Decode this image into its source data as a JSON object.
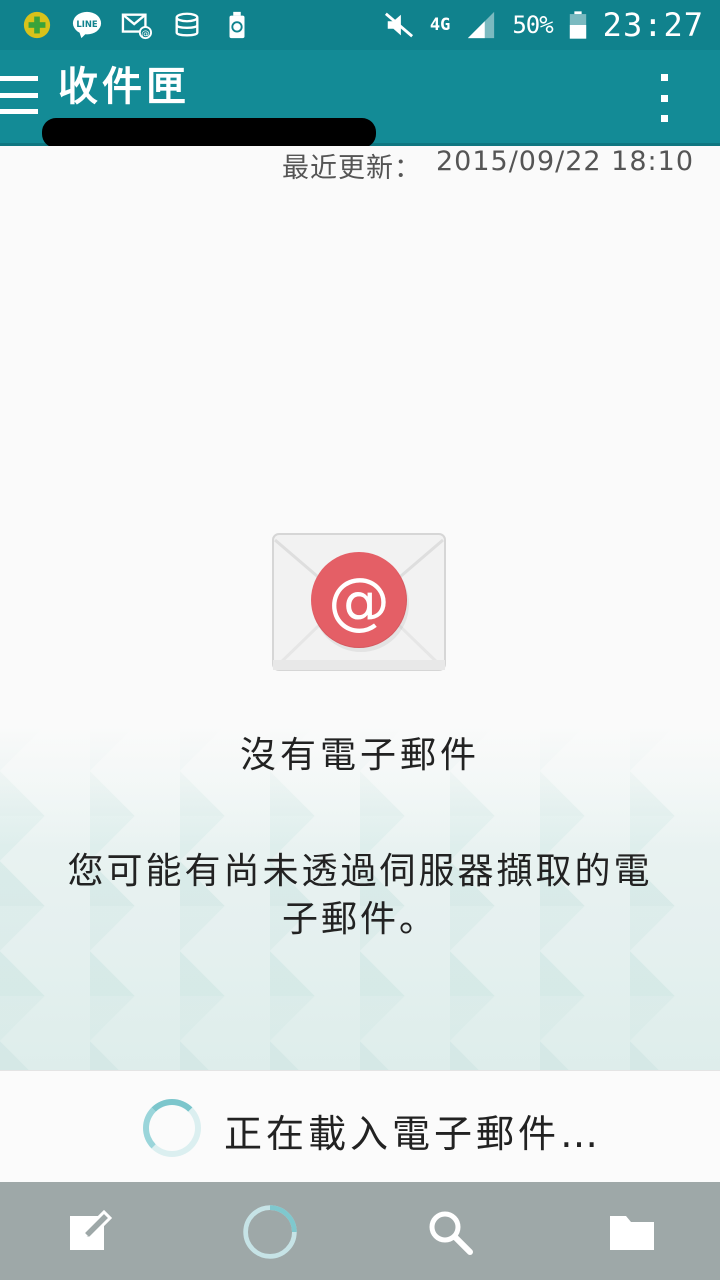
{
  "status_bar": {
    "network_type": "4G",
    "battery_percent": "50%",
    "time": "23:27",
    "icons": [
      "plus-badge-icon",
      "line-icon",
      "mail-at-icon",
      "database-icon",
      "recycle-icon",
      "mute-icon",
      "signal-icon",
      "battery-icon"
    ]
  },
  "app_bar": {
    "title": "收件匣"
  },
  "content": {
    "last_updated_label": "最近更新：",
    "last_updated_value": "2015/09/22 18:10",
    "empty_title": "沒有電子郵件",
    "empty_description": "您可能有尚未透過伺服器擷取的電子郵件。"
  },
  "loading": {
    "text": "正在載入電子郵件…"
  },
  "toolbar": {
    "icons": [
      "compose-icon",
      "refresh-icon",
      "search-icon",
      "folder-icon"
    ]
  },
  "colors": {
    "status_bar": "#10828d",
    "app_bar": "#138b96",
    "accent_red": "#e45f66",
    "toolbar": "#9ea8a8"
  }
}
